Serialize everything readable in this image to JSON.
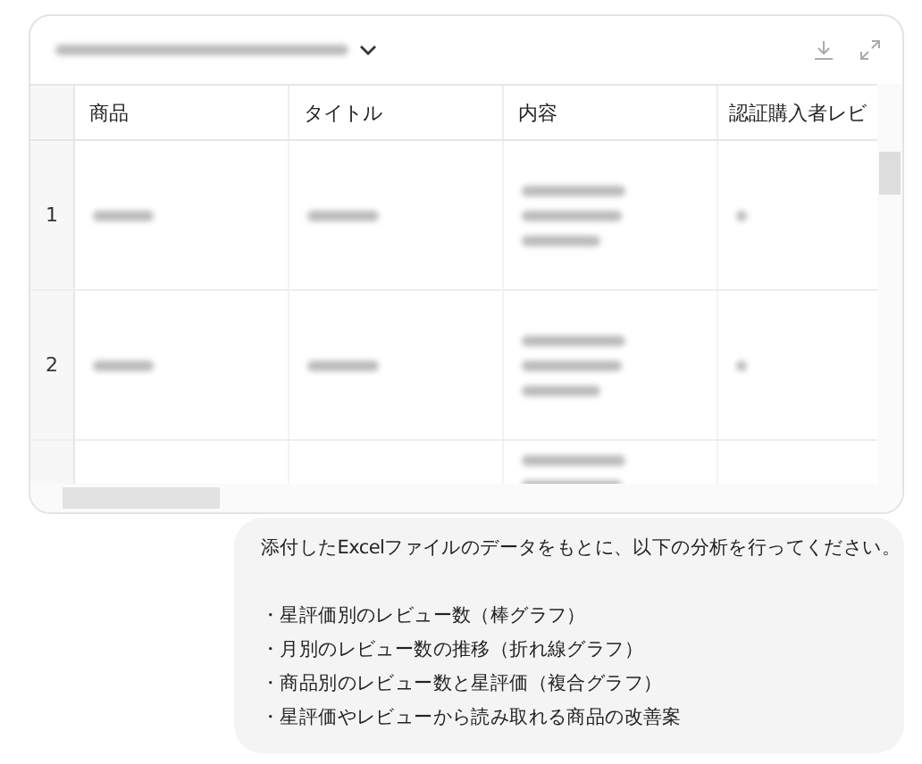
{
  "table": {
    "columns": [
      "商品",
      "タイトル",
      "内容",
      "認証購入者レビ"
    ],
    "rows": [
      {
        "number": "1"
      },
      {
        "number": "2"
      },
      {}
    ]
  },
  "message": {
    "intro": "添付したExcelファイルのデータをもとに、以下の分析を行ってください。",
    "items": [
      "・星評価別のレビュー数（棒グラフ）",
      "・月別のレビュー数の推移（折れ線グラフ）",
      "・商品別のレビュー数と星評価（複合グラフ）",
      "・星評価やレビューから読み取れる商品の改善案"
    ]
  }
}
